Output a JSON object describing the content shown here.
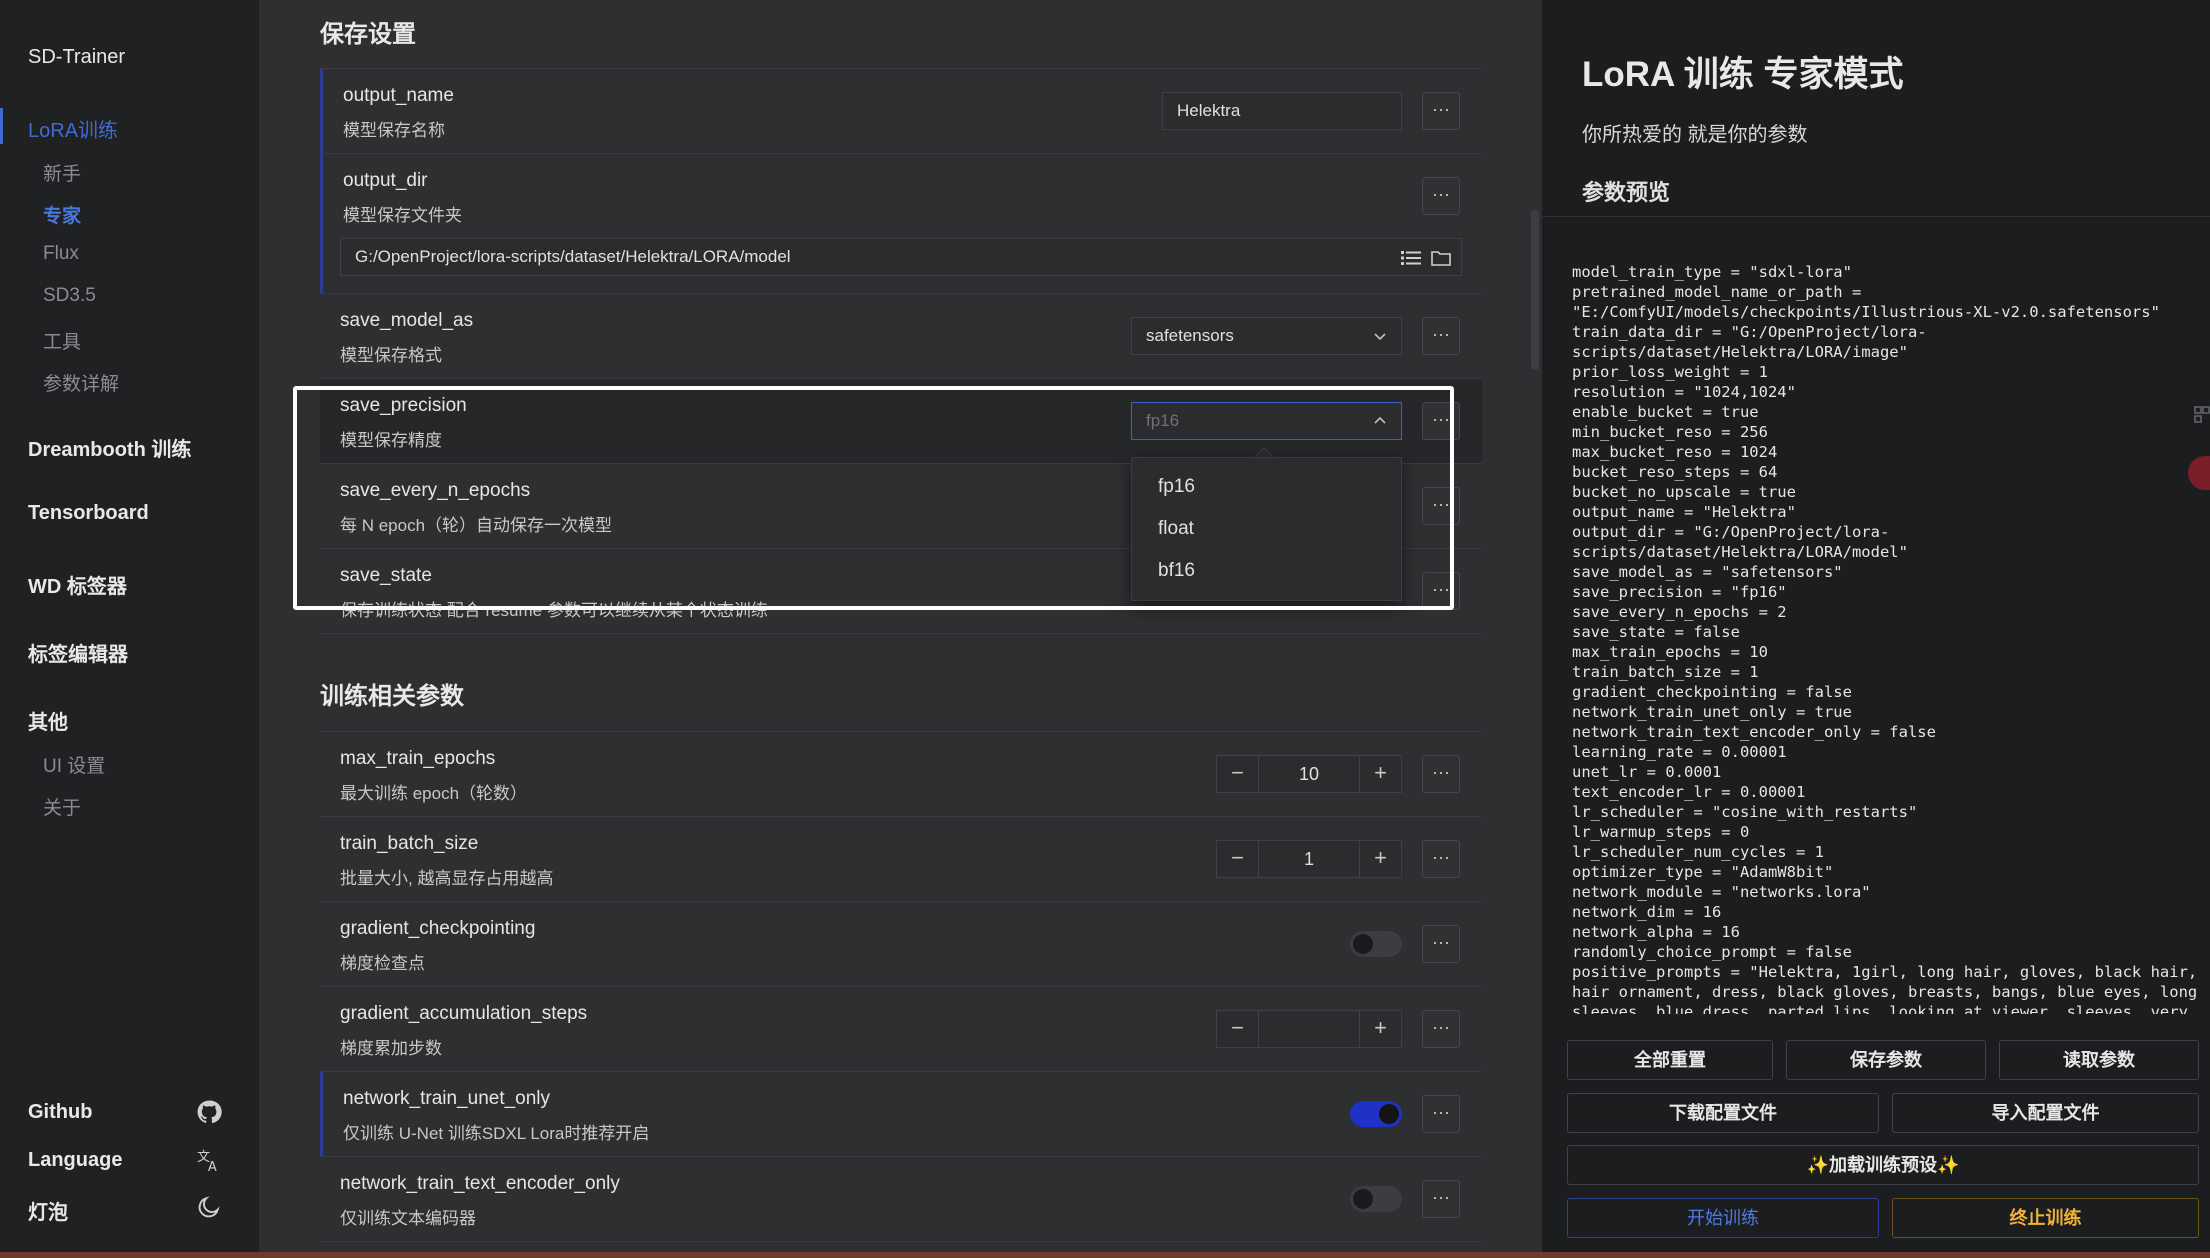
{
  "sidebar": {
    "brand": "SD-Trainer",
    "lora_group": "LoRA训练",
    "lora_items": [
      "新手",
      "专家",
      "Flux",
      "SD3.5",
      "工具",
      "参数详解"
    ],
    "groups": [
      "Dreambooth 训练",
      "Tensorboard",
      "WD 标签器",
      "标签编辑器",
      "其他"
    ],
    "other_items": [
      "UI 设置",
      "关于"
    ],
    "footer": {
      "github": "Github",
      "language": "Language",
      "theme": "灯泡"
    }
  },
  "main": {
    "save_section": "保存设置",
    "train_section": "训练相关参数",
    "params": {
      "output_name": {
        "name": "output_name",
        "desc": "模型保存名称",
        "value": "Helektra"
      },
      "output_dir": {
        "name": "output_dir",
        "desc": "模型保存文件夹",
        "value": "G:/OpenProject/lora-scripts/dataset/Helektra/LORA/model"
      },
      "save_model_as": {
        "name": "save_model_as",
        "desc": "模型保存格式",
        "value": "safetensors"
      },
      "save_precision": {
        "name": "save_precision",
        "desc": "模型保存精度",
        "value": "fp16"
      },
      "save_every_n_epochs": {
        "name": "save_every_n_epochs",
        "desc": "每 N epoch（轮）自动保存一次模型"
      },
      "save_state": {
        "name": "save_state",
        "desc": "保存训练状态 配合 resume 参数可以继续从某个状态训练"
      },
      "max_train_epochs": {
        "name": "max_train_epochs",
        "desc": "最大训练 epoch（轮数）",
        "value": "10"
      },
      "train_batch_size": {
        "name": "train_batch_size",
        "desc": "批量大小, 越高显存占用越高",
        "value": "1"
      },
      "gradient_checkpointing": {
        "name": "gradient_checkpointing",
        "desc": "梯度检查点",
        "on": false
      },
      "gradient_accumulation_steps": {
        "name": "gradient_accumulation_steps",
        "desc": "梯度累加步数",
        "value": ""
      },
      "network_train_unet_only": {
        "name": "network_train_unet_only",
        "desc": "仅训练 U-Net 训练SDXL Lora时推荐开启",
        "on": true
      },
      "network_train_text_encoder_only": {
        "name": "network_train_text_encoder_only",
        "desc": "仅训练文本编码器",
        "on": false
      }
    },
    "dots_label": "···",
    "stepper_minus": "−",
    "stepper_plus": "+",
    "precision_options": [
      "fp16",
      "float",
      "bf16"
    ]
  },
  "right": {
    "title": "LoRA 训练 专家模式",
    "subtitle": "你所热爱的 就是你的参数",
    "preview_title": "参数预览",
    "config_text": "model_train_type = \"sdxl-lora\"\npretrained_model_name_or_path =\n\"E:/ComfyUI/models/checkpoints/Illustrious-XL-v2.0.safetensors\"\ntrain_data_dir = \"G:/OpenProject/lora-\nscripts/dataset/Helektra/LORA/image\"\nprior_loss_weight = 1\nresolution = \"1024,1024\"\nenable_bucket = true\nmin_bucket_reso = 256\nmax_bucket_reso = 1024\nbucket_reso_steps = 64\nbucket_no_upscale = true\noutput_name = \"Helektra\"\noutput_dir = \"G:/OpenProject/lora-\nscripts/dataset/Helektra/LORA/model\"\nsave_model_as = \"safetensors\"\nsave_precision = \"fp16\"\nsave_every_n_epochs = 2\nsave_state = false\nmax_train_epochs = 10\ntrain_batch_size = 1\ngradient_checkpointing = false\nnetwork_train_unet_only = true\nnetwork_train_text_encoder_only = false\nlearning_rate = 0.00001\nunet_lr = 0.0001\ntext_encoder_lr = 0.00001\nlr_scheduler = \"cosine_with_restarts\"\nlr_warmup_steps = 0\nlr_scheduler_num_cycles = 1\noptimizer_type = \"AdamW8bit\"\nnetwork_module = \"networks.lora\"\nnetwork_dim = 16\nnetwork_alpha = 16\nrandomly_choice_prompt = false\npositive_prompts = \"Helektra, 1girl, long hair, gloves, black hair,\nhair ornament, dress, black gloves, breasts, bangs, blue eyes, long\nsleeves, blue dress, parted lips, looking at viewer, sleeves, very",
    "buttons": {
      "reset": "全部重置",
      "save": "保存参数",
      "load": "读取参数",
      "download": "下载配置文件",
      "import": "导入配置文件",
      "preset": "✨加载训练预设✨",
      "start": "开始训练",
      "stop": "终止训练"
    }
  },
  "colors": {
    "accent": "#3f6bd6",
    "toggle_on": "#1e33c6",
    "warn": "#f0b23a",
    "background": "#2d2f31",
    "panel": "#1c1d1f"
  }
}
